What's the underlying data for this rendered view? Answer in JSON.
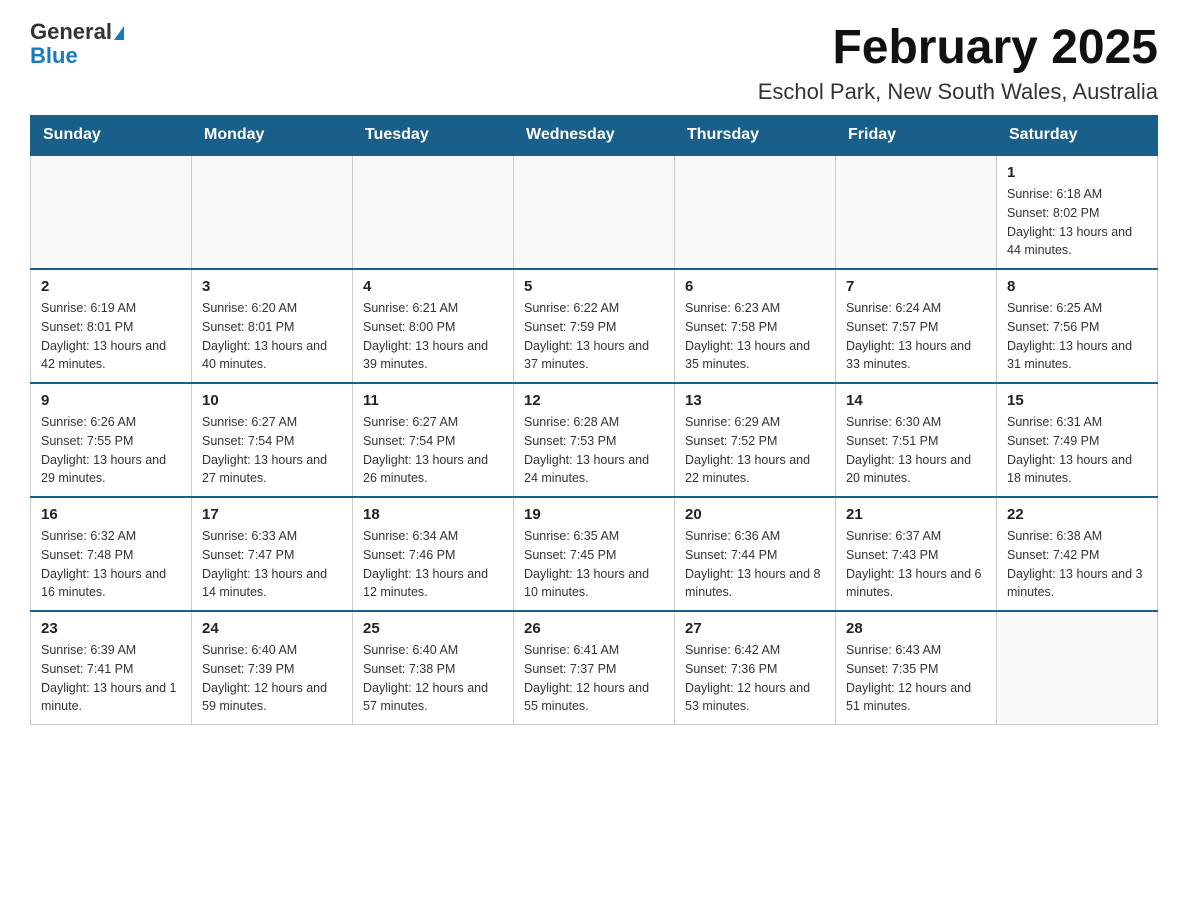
{
  "logo": {
    "general": "General",
    "blue": "Blue"
  },
  "title": "February 2025",
  "subtitle": "Eschol Park, New South Wales, Australia",
  "weekdays": [
    "Sunday",
    "Monday",
    "Tuesday",
    "Wednesday",
    "Thursday",
    "Friday",
    "Saturday"
  ],
  "weeks": [
    [
      {
        "day": "",
        "info": ""
      },
      {
        "day": "",
        "info": ""
      },
      {
        "day": "",
        "info": ""
      },
      {
        "day": "",
        "info": ""
      },
      {
        "day": "",
        "info": ""
      },
      {
        "day": "",
        "info": ""
      },
      {
        "day": "1",
        "info": "Sunrise: 6:18 AM\nSunset: 8:02 PM\nDaylight: 13 hours and 44 minutes."
      }
    ],
    [
      {
        "day": "2",
        "info": "Sunrise: 6:19 AM\nSunset: 8:01 PM\nDaylight: 13 hours and 42 minutes."
      },
      {
        "day": "3",
        "info": "Sunrise: 6:20 AM\nSunset: 8:01 PM\nDaylight: 13 hours and 40 minutes."
      },
      {
        "day": "4",
        "info": "Sunrise: 6:21 AM\nSunset: 8:00 PM\nDaylight: 13 hours and 39 minutes."
      },
      {
        "day": "5",
        "info": "Sunrise: 6:22 AM\nSunset: 7:59 PM\nDaylight: 13 hours and 37 minutes."
      },
      {
        "day": "6",
        "info": "Sunrise: 6:23 AM\nSunset: 7:58 PM\nDaylight: 13 hours and 35 minutes."
      },
      {
        "day": "7",
        "info": "Sunrise: 6:24 AM\nSunset: 7:57 PM\nDaylight: 13 hours and 33 minutes."
      },
      {
        "day": "8",
        "info": "Sunrise: 6:25 AM\nSunset: 7:56 PM\nDaylight: 13 hours and 31 minutes."
      }
    ],
    [
      {
        "day": "9",
        "info": "Sunrise: 6:26 AM\nSunset: 7:55 PM\nDaylight: 13 hours and 29 minutes."
      },
      {
        "day": "10",
        "info": "Sunrise: 6:27 AM\nSunset: 7:54 PM\nDaylight: 13 hours and 27 minutes."
      },
      {
        "day": "11",
        "info": "Sunrise: 6:27 AM\nSunset: 7:54 PM\nDaylight: 13 hours and 26 minutes."
      },
      {
        "day": "12",
        "info": "Sunrise: 6:28 AM\nSunset: 7:53 PM\nDaylight: 13 hours and 24 minutes."
      },
      {
        "day": "13",
        "info": "Sunrise: 6:29 AM\nSunset: 7:52 PM\nDaylight: 13 hours and 22 minutes."
      },
      {
        "day": "14",
        "info": "Sunrise: 6:30 AM\nSunset: 7:51 PM\nDaylight: 13 hours and 20 minutes."
      },
      {
        "day": "15",
        "info": "Sunrise: 6:31 AM\nSunset: 7:49 PM\nDaylight: 13 hours and 18 minutes."
      }
    ],
    [
      {
        "day": "16",
        "info": "Sunrise: 6:32 AM\nSunset: 7:48 PM\nDaylight: 13 hours and 16 minutes."
      },
      {
        "day": "17",
        "info": "Sunrise: 6:33 AM\nSunset: 7:47 PM\nDaylight: 13 hours and 14 minutes."
      },
      {
        "day": "18",
        "info": "Sunrise: 6:34 AM\nSunset: 7:46 PM\nDaylight: 13 hours and 12 minutes."
      },
      {
        "day": "19",
        "info": "Sunrise: 6:35 AM\nSunset: 7:45 PM\nDaylight: 13 hours and 10 minutes."
      },
      {
        "day": "20",
        "info": "Sunrise: 6:36 AM\nSunset: 7:44 PM\nDaylight: 13 hours and 8 minutes."
      },
      {
        "day": "21",
        "info": "Sunrise: 6:37 AM\nSunset: 7:43 PM\nDaylight: 13 hours and 6 minutes."
      },
      {
        "day": "22",
        "info": "Sunrise: 6:38 AM\nSunset: 7:42 PM\nDaylight: 13 hours and 3 minutes."
      }
    ],
    [
      {
        "day": "23",
        "info": "Sunrise: 6:39 AM\nSunset: 7:41 PM\nDaylight: 13 hours and 1 minute."
      },
      {
        "day": "24",
        "info": "Sunrise: 6:40 AM\nSunset: 7:39 PM\nDaylight: 12 hours and 59 minutes."
      },
      {
        "day": "25",
        "info": "Sunrise: 6:40 AM\nSunset: 7:38 PM\nDaylight: 12 hours and 57 minutes."
      },
      {
        "day": "26",
        "info": "Sunrise: 6:41 AM\nSunset: 7:37 PM\nDaylight: 12 hours and 55 minutes."
      },
      {
        "day": "27",
        "info": "Sunrise: 6:42 AM\nSunset: 7:36 PM\nDaylight: 12 hours and 53 minutes."
      },
      {
        "day": "28",
        "info": "Sunrise: 6:43 AM\nSunset: 7:35 PM\nDaylight: 12 hours and 51 minutes."
      },
      {
        "day": "",
        "info": ""
      }
    ]
  ]
}
